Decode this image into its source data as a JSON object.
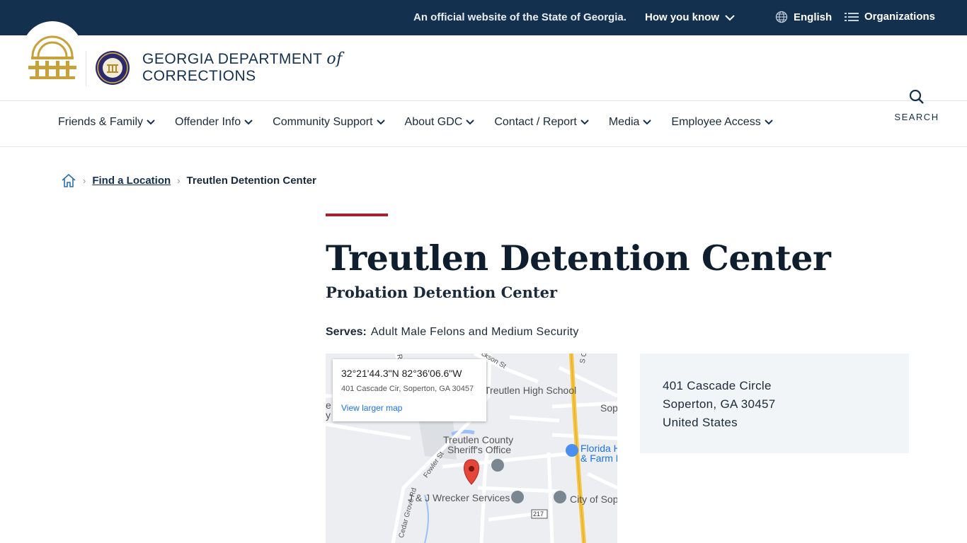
{
  "topbar": {
    "official_text": "An official website of the State of Georgia.",
    "how_you_know": "How you know",
    "language": "English",
    "organizations": "Organizations"
  },
  "header": {
    "brand_line1": "GEORGIA DEPARTMENT",
    "brand_of": "of",
    "brand_line2": "CORRECTIONS",
    "search_label": "SEARCH"
  },
  "nav": {
    "items": [
      {
        "label": "Friends & Family"
      },
      {
        "label": "Offender Info"
      },
      {
        "label": "Community Support"
      },
      {
        "label": "About GDC"
      },
      {
        "label": "Contact / Report"
      },
      {
        "label": "Media"
      },
      {
        "label": "Employee Access"
      }
    ]
  },
  "breadcrumb": {
    "home_icon": "home-icon",
    "link": "Find a Location",
    "current": "Treutlen Detention Center"
  },
  "page": {
    "title": "Treutlen Detention Center",
    "subtitle": "Probation Detention Center",
    "serves_label": "Serves:",
    "serves_value": "Adult Male Felons and Medium Security"
  },
  "map": {
    "coords": "32°21'44.3\"N 82°36'06.6\"W",
    "address": "401 Cascade Cir, Soperton, GA 30457",
    "view_larger": "View larger map",
    "labels": {
      "treutlen_high": "Treutlen High School",
      "sheriff_1": "Treutlen County",
      "sheriff_2": "Sheriff's Office",
      "florida_1": "Florida H",
      "florida_2": "& Farm E",
      "wrecker": "J & J Wrecker Services",
      "city": "City of Sop",
      "sop": "Sop",
      "fowler": "Fowler St",
      "cedar": "Cedar Grove Rd",
      "route": "217",
      "jackson": "ckson St",
      "ro": "Ro",
      "s_o": "S O",
      "e": "e",
      "y": "y"
    }
  },
  "address": {
    "line1": "401 Cascade Circle",
    "line2": "Soperton, GA 30457",
    "line3": "United States"
  },
  "colors": {
    "topbar": "#14304f",
    "accent_red": "#a8202b",
    "gold": "#c9a13b",
    "panel_bg": "#f2f5f8"
  }
}
